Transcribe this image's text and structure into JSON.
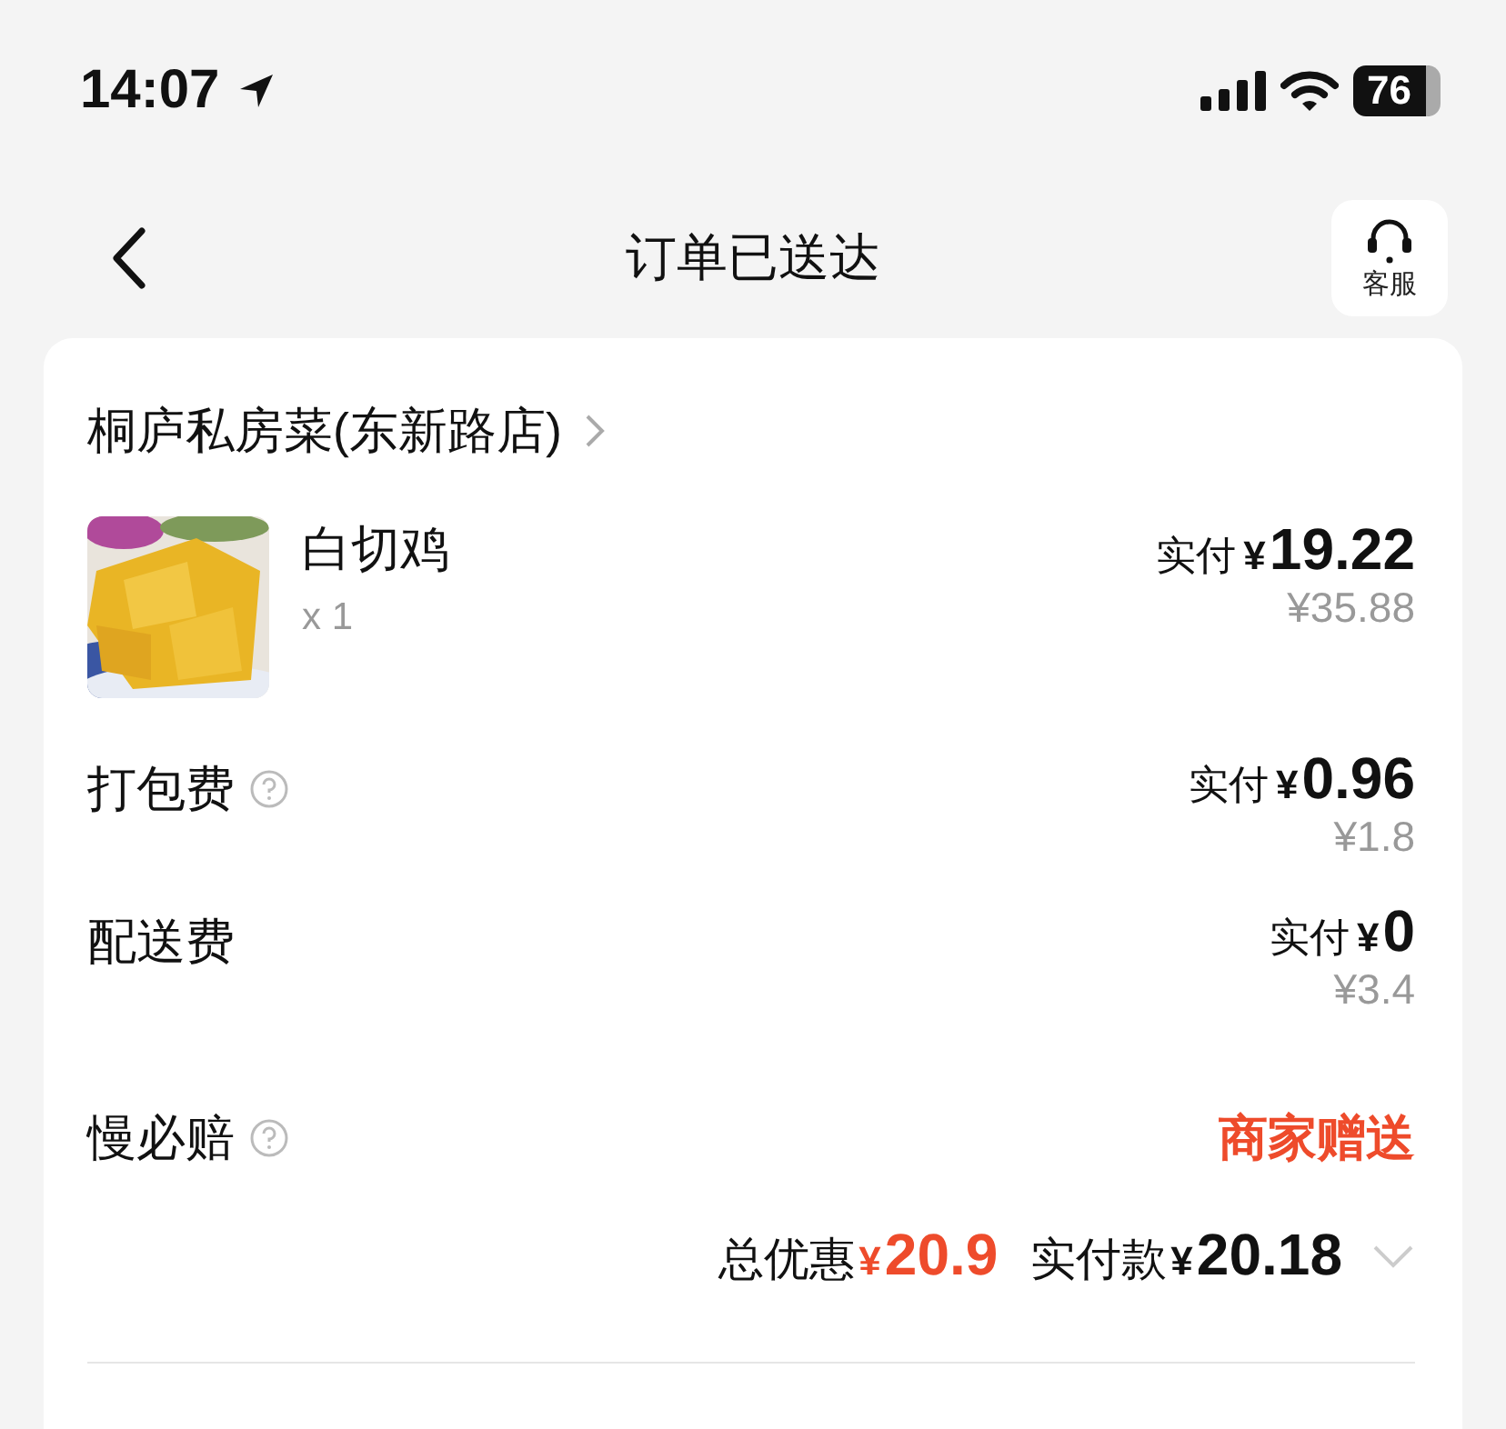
{
  "status_bar": {
    "time": "14:07",
    "battery": "76"
  },
  "nav": {
    "title": "订单已送达",
    "service_label": "客服"
  },
  "shop": {
    "name": "桐庐私房菜(东新路店)"
  },
  "items": [
    {
      "name": "白切鸡",
      "quantity": "x 1",
      "paid_label": "实付",
      "currency": "¥",
      "paid": "19.22",
      "original": "¥35.88"
    }
  ],
  "fees": [
    {
      "kind": "price",
      "label": "打包费",
      "help": true,
      "paid_label": "实付",
      "currency": "¥",
      "paid": "0.96",
      "original": "¥1.8"
    },
    {
      "kind": "price",
      "label": "配送费",
      "help": false,
      "paid_label": "实付",
      "currency": "¥",
      "paid": "0",
      "original": "¥3.4"
    },
    {
      "kind": "note",
      "label": "慢必赔",
      "help": true,
      "note": "商家赠送"
    }
  ],
  "summary": {
    "discount_label": "总优惠",
    "discount_currency": "¥",
    "discount": "20.9",
    "total_label": "实付款",
    "total_currency": "¥",
    "total": "20.18",
    "expanded": false
  }
}
